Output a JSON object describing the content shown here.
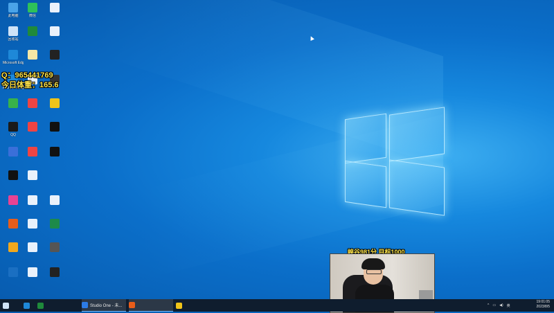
{
  "overlays": {
    "qq_line": "Q：965441769",
    "weight_line": "今日体重：165.6",
    "goal_line": "峡谷981分 目标1000"
  },
  "desktop_icons": [
    {
      "label": "此电脑",
      "icon": "computer-icon",
      "color": "#4aa3e8"
    },
    {
      "label": "微信",
      "icon": "wechat-icon",
      "color": "#2ec15a"
    },
    {
      "label": "",
      "icon": "document-icon",
      "color": "#e9f1fb"
    },
    {
      "label": "回收站",
      "icon": "recycle-bin-icon",
      "color": "#cfe3f7"
    },
    {
      "label": "",
      "icon": "app-icon",
      "color": "#1f8a3b"
    },
    {
      "label": "",
      "icon": "document-icon",
      "color": "#e9f1fb"
    },
    {
      "label": "Microsoft Edge",
      "icon": "edge-icon",
      "color": "#1e88d8"
    },
    {
      "label": "",
      "icon": "document-icon",
      "color": "#f5e7a6"
    },
    {
      "label": "",
      "icon": "terminal-icon",
      "color": "#222"
    },
    {
      "label": "Microsoft Edge",
      "icon": "edge-icon",
      "color": "#1e88d8"
    },
    {
      "label": "",
      "icon": "document-icon",
      "color": "#e9f1fb"
    },
    {
      "label": "",
      "icon": "terminal-icon",
      "color": "#333"
    },
    {
      "label": "",
      "icon": "app-icon",
      "color": "#38b24a"
    },
    {
      "label": "",
      "icon": "phone-icon",
      "color": "#e44"
    },
    {
      "label": "",
      "icon": "search-icon",
      "color": "#f0c419"
    },
    {
      "label": "QQ",
      "icon": "qq-icon",
      "color": "#1a1a1a"
    },
    {
      "label": "",
      "icon": "phone-icon",
      "color": "#e44"
    },
    {
      "label": "",
      "icon": "tiktok-icon",
      "color": "#111"
    },
    {
      "label": "",
      "icon": "app-icon",
      "color": "#3a6fd9"
    },
    {
      "label": "",
      "icon": "phone-icon",
      "color": "#e44"
    },
    {
      "label": "",
      "icon": "app-icon",
      "color": "#111"
    },
    {
      "label": "",
      "icon": "app-icon",
      "color": "#111"
    },
    {
      "label": "",
      "icon": "document-icon",
      "color": "#e9f1fb"
    },
    {
      "label": "",
      "icon": "blank",
      "color": "transparent"
    },
    {
      "label": "",
      "icon": "app-icon",
      "color": "#e84393"
    },
    {
      "label": "",
      "icon": "document-icon",
      "color": "#e9f1fb"
    },
    {
      "label": "",
      "icon": "document-icon",
      "color": "#e9f1fb"
    },
    {
      "label": "",
      "icon": "app-icon",
      "color": "#e85d1a"
    },
    {
      "label": "",
      "icon": "document-icon",
      "color": "#e9f1fb"
    },
    {
      "label": "",
      "icon": "excel-icon",
      "color": "#1d8a4a"
    },
    {
      "label": "",
      "icon": "app-icon",
      "color": "#f0a81e"
    },
    {
      "label": "",
      "icon": "document-icon",
      "color": "#e9f1fb"
    },
    {
      "label": "",
      "icon": "document-icon",
      "color": "#555"
    },
    {
      "label": "",
      "icon": "app-icon",
      "color": "#1a6fc2"
    },
    {
      "label": "",
      "icon": "document-icon",
      "color": "#e9f1fb"
    },
    {
      "label": "",
      "icon": "terminal-icon",
      "color": "#222"
    }
  ],
  "taskbar": {
    "items": [
      {
        "label": "",
        "icon": "windows-start-icon",
        "color": "#cfe3f7"
      },
      {
        "label": "",
        "icon": "edge-icon",
        "color": "#1e88d8"
      },
      {
        "label": "",
        "icon": "app-icon",
        "color": "#1f8a3b"
      },
      {
        "label": "Studio One - 未...",
        "icon": "studio-one-icon",
        "color": "#2c7be5"
      },
      {
        "label": "",
        "icon": "app-icon",
        "color": "#e85d1a"
      },
      {
        "label": "",
        "icon": "app-icon",
        "color": "#f0c419"
      }
    ],
    "tray_text": "英",
    "clock_time": "19:01:05",
    "clock_date": "2023/8/5"
  }
}
